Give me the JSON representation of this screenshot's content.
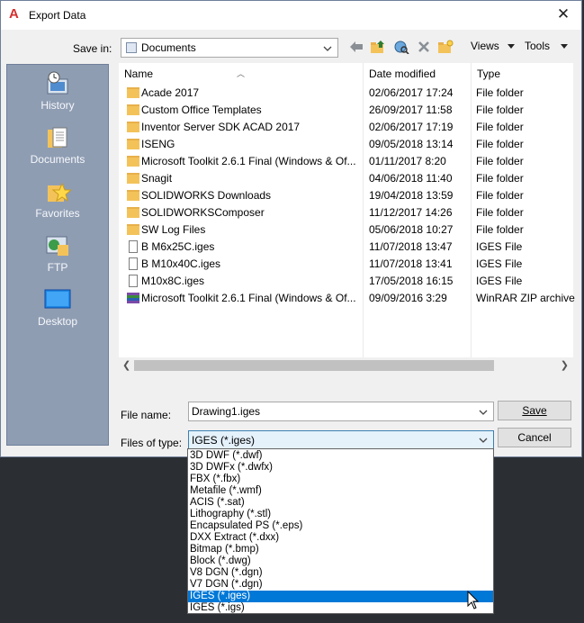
{
  "window": {
    "title": "Export Data",
    "close_glyph": "✕"
  },
  "toolbar": {
    "save_in_label": "Save in:",
    "save_in_value": "Documents",
    "views_label": "Views",
    "tools_label": "Tools",
    "icons": [
      "back-arrow-icon",
      "up-folder-icon",
      "search-web-icon",
      "delete-icon",
      "new-folder-icon"
    ]
  },
  "places": [
    {
      "label": "History",
      "icon": "history-icon"
    },
    {
      "label": "Documents",
      "icon": "documents-icon"
    },
    {
      "label": "Favorites",
      "icon": "favorites-icon"
    },
    {
      "label": "FTP",
      "icon": "ftp-icon"
    },
    {
      "label": "Desktop",
      "icon": "desktop-icon"
    }
  ],
  "columns": {
    "name": "Name",
    "date": "Date modified",
    "type": "Type"
  },
  "files": [
    {
      "name": "Acade 2017",
      "date": "02/06/2017 17:24",
      "type": "File folder",
      "kind": "folder"
    },
    {
      "name": "Custom Office Templates",
      "date": "26/09/2017 11:58",
      "type": "File folder",
      "kind": "folder"
    },
    {
      "name": "Inventor Server SDK ACAD 2017",
      "date": "02/06/2017 17:19",
      "type": "File folder",
      "kind": "folder"
    },
    {
      "name": "ISENG",
      "date": "09/05/2018 13:14",
      "type": "File folder",
      "kind": "folder"
    },
    {
      "name": "Microsoft Toolkit 2.6.1 Final (Windows & Of...",
      "date": "01/11/2017 8:20",
      "type": "File folder",
      "kind": "folder"
    },
    {
      "name": "Snagit",
      "date": "04/06/2018 11:40",
      "type": "File folder",
      "kind": "folder"
    },
    {
      "name": "SOLIDWORKS Downloads",
      "date": "19/04/2018 13:59",
      "type": "File folder",
      "kind": "folder"
    },
    {
      "name": "SOLIDWORKSComposer",
      "date": "11/12/2017 14:26",
      "type": "File folder",
      "kind": "folder"
    },
    {
      "name": "SW Log Files",
      "date": "05/06/2018 10:27",
      "type": "File folder",
      "kind": "folder"
    },
    {
      "name": "B M6x25C.iges",
      "date": "11/07/2018 13:47",
      "type": "IGES File",
      "kind": "file"
    },
    {
      "name": "B M10x40C.iges",
      "date": "11/07/2018 13:41",
      "type": "IGES File",
      "kind": "file"
    },
    {
      "name": "M10x8C.iges",
      "date": "17/05/2018 16:15",
      "type": "IGES File",
      "kind": "file"
    },
    {
      "name": "Microsoft Toolkit 2.6.1 Final (Windows & Of...",
      "date": "09/09/2016 3:29",
      "type": "WinRAR ZIP archive",
      "kind": "zip"
    }
  ],
  "form": {
    "file_name_label": "File name:",
    "file_name_value": "Drawing1.iges",
    "files_of_type_label": "Files of type:",
    "files_of_type_value": "IGES (*.iges)",
    "save_label": "Save",
    "cancel_label": "Cancel"
  },
  "type_options": [
    "3D DWF (*.dwf)",
    "3D DWFx (*.dwfx)",
    "FBX (*.fbx)",
    "Metafile (*.wmf)",
    "ACIS (*.sat)",
    "Lithography (*.stl)",
    "Encapsulated PS (*.eps)",
    "DXX Extract (*.dxx)",
    "Bitmap (*.bmp)",
    "Block (*.dwg)",
    "V8 DGN (*.dgn)",
    "V7 DGN (*.dgn)",
    "IGES (*.iges)",
    "IGES (*.igs)"
  ],
  "selected_type_index": 12,
  "colors": {
    "accent": "#0078d7",
    "places_bg": "#8f9db3",
    "folder": "#f3c35a"
  }
}
